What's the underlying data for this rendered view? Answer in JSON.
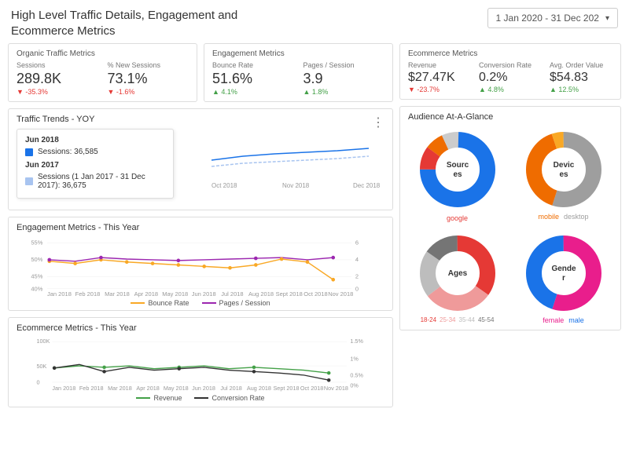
{
  "header": {
    "title": "High Level Traffic Details, Engagement and Ecommerce Metrics",
    "date_range": "1 Jan 2020 - 31 Dec 202"
  },
  "organic_metrics": {
    "title": "Organic Traffic Metrics",
    "sessions": {
      "label": "Sessions",
      "value": "289.8K",
      "change": "-35.3%",
      "direction": "down"
    },
    "new_sessions": {
      "label": "% New Sessions",
      "value": "73.1%",
      "change": "-1.6%",
      "direction": "down"
    }
  },
  "engagement_metrics": {
    "title": "Engagement Metrics",
    "bounce_rate": {
      "label": "Bounce Rate",
      "value": "51.6%",
      "change": "4.1%",
      "direction": "up"
    },
    "pages_session": {
      "label": "Pages / Session",
      "value": "3.9",
      "change": "1.8%",
      "direction": "up"
    }
  },
  "ecommerce_metrics": {
    "title": "Ecommerce Metrics",
    "revenue": {
      "label": "Revenue",
      "value": "$27.47K",
      "change": "-23.7%",
      "direction": "down"
    },
    "conversion_rate": {
      "label": "Conversion Rate",
      "value": "0.2%",
      "change": "4.8%",
      "direction": "up"
    },
    "avg_order": {
      "label": "Avg. Order Value",
      "value": "$54.83",
      "change": "12.5%",
      "direction": "up"
    }
  },
  "traffic_trends": {
    "title": "Traffic Trends - YOY",
    "tooltip": {
      "year1": "Jun 2018",
      "year1_metric": "Sessions: 36,585",
      "year2": "Jun 2017",
      "year2_metric": "Sessions (1 Jan 2017 - 31 Dec 2017): 36,675"
    }
  },
  "engagement_chart": {
    "title": "Engagement Metrics - This Year",
    "legend": [
      {
        "label": "Bounce Rate",
        "color": "#f9a825"
      },
      {
        "label": "Pages / Session",
        "color": "#9c27b0"
      }
    ]
  },
  "ecommerce_chart": {
    "title": "Ecommerce Metrics - This Year",
    "legend": [
      {
        "label": "Revenue",
        "color": "#43a047"
      },
      {
        "label": "Conversion Rate",
        "color": "#333"
      }
    ]
  },
  "audience": {
    "title": "Audience At-A-Glance",
    "sources": {
      "label": "Sourc\nes",
      "sublabel": "google"
    },
    "devices": {
      "label": "Devic\nes",
      "sublabels": [
        "mobile",
        "desktop"
      ]
    },
    "ages": {
      "label": "Ages",
      "segments": [
        "18-24",
        "25-34",
        "35-44",
        "45-54"
      ]
    },
    "gender": {
      "label": "Gende\nr",
      "segments": [
        "female",
        "male"
      ]
    }
  }
}
